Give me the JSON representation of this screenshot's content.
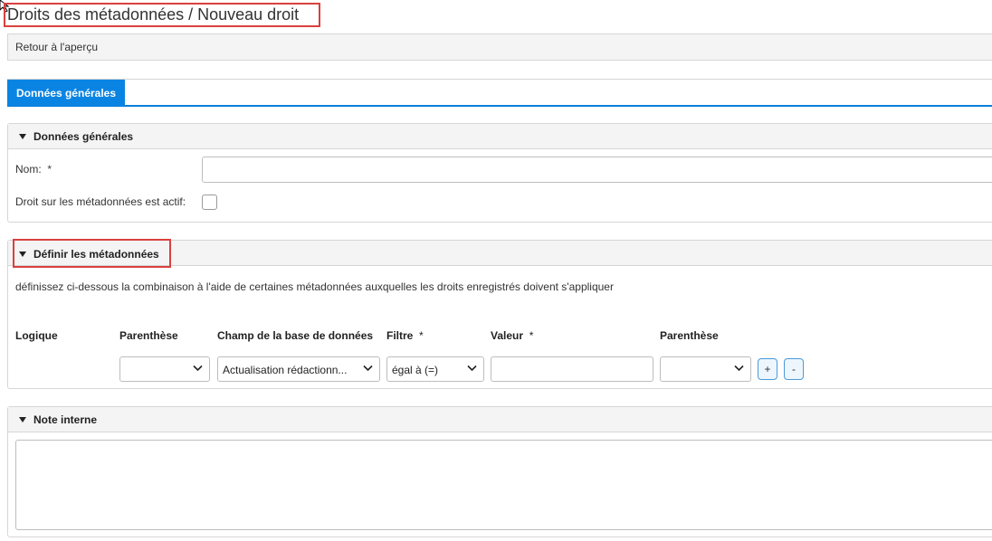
{
  "page_title": "Droits des métadonnées / Nouveau droit",
  "back_link": "Retour à l'aperçu",
  "tabs": [
    {
      "label": "Données générales",
      "active": true
    }
  ],
  "general_section": {
    "title": "Données générales",
    "name_label": "Nom:",
    "required_marker": "*",
    "name_value": "",
    "active_label": "Droit sur les métadonnées est actif:",
    "active_checked": false
  },
  "metadata_section": {
    "title": "Définir les métadonnées",
    "description": "définissez ci-dessous la combinaison à l'aide de certaines métadonnées auxquelles les droits enregistrés doivent s'appliquer",
    "columns": {
      "logic": "Logique",
      "paren_open": "Parenthèse",
      "db_field": "Champ de la base de données",
      "filter": "Filtre",
      "value": "Valeur",
      "paren_close": "Parenthèse",
      "required_marker": "*"
    },
    "row": {
      "paren_open": "",
      "db_field": "Actualisation rédactionn...",
      "filter": "égal à (=)",
      "value": "",
      "paren_close": ""
    },
    "add_label": "+",
    "remove_label": "-"
  },
  "note_section": {
    "title": "Note interne",
    "value": ""
  },
  "colors": {
    "accent": "#0a84e3",
    "highlight": "#d9413f",
    "header_bg": "#f4f4f4"
  }
}
